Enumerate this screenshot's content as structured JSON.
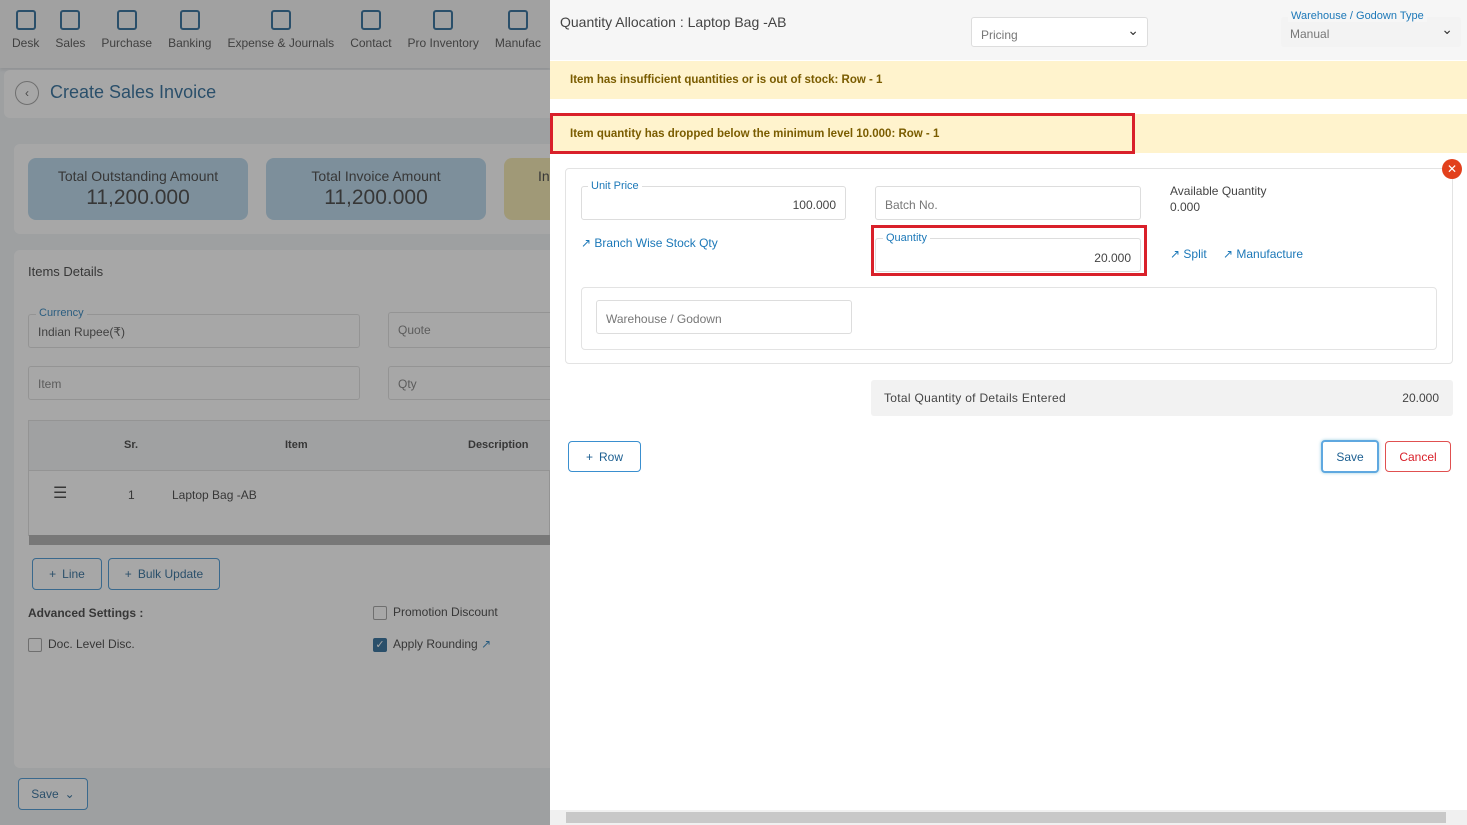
{
  "nav": [
    "Desk",
    "Sales",
    "Purchase",
    "Banking",
    "Expense & Journals",
    "Contact",
    "Pro Inventory",
    "Manufac"
  ],
  "page": {
    "title": "Create Sales Invoice"
  },
  "stats": [
    {
      "label": "Total Outstanding Amount",
      "value": "11,200.000"
    },
    {
      "label": "Total Invoice Amount",
      "value": "11,200.000"
    },
    {
      "label": "In",
      "value": ""
    }
  ],
  "items": {
    "title": "Items Details",
    "currency_label": "Currency",
    "currency_value": "Indian Rupee(₹)",
    "quote_placeholder": "Quote",
    "item_placeholder": "Item",
    "qty_placeholder": "Qty",
    "columns": [
      "Sr.",
      "Item",
      "Description"
    ],
    "rows": [
      {
        "sr": "1",
        "item": "Laptop Bag -AB",
        "description": ""
      }
    ],
    "line_btn": "Line",
    "bulk_btn": "Bulk Update"
  },
  "advanced": {
    "title": "Advanced Settings :",
    "promotion": "Promotion Discount",
    "doc_disc": "Doc. Level Disc.",
    "rounding": "Apply Rounding",
    "rounding_checked": true
  },
  "footer": {
    "save": "Save"
  },
  "panel": {
    "title": "Quantity Allocation : Laptop Bag -AB",
    "pricing": "Pricing",
    "wh_type_label": "Warehouse / Godown Type",
    "wh_type_value": "Manual",
    "alert1": "Item has insufficient quantities or is out of stock: Row - 1",
    "alert2": "Item quantity has dropped below the minimum level 10.000: Row - 1",
    "unit_price_label": "Unit Price",
    "unit_price": "100.000",
    "batch_placeholder": "Batch No.",
    "avail_label": "Available Quantity",
    "avail_value": "0.000",
    "branch_link": "Branch Wise Stock Qty",
    "qty_label": "Quantity",
    "qty": "20.000",
    "split": "Split",
    "manufacture": "Manufacture",
    "warehouse_placeholder": "Warehouse / Godown",
    "total_label": "Total Quantity of Details Entered",
    "total_value": "20.000",
    "row_btn": "Row",
    "save": "Save",
    "cancel": "Cancel"
  },
  "colors": {
    "accent": "#1c78b8",
    "alert_bg": "#fff3cd",
    "highlight": "#d9202a"
  }
}
